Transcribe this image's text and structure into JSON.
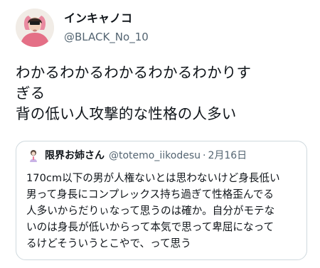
{
  "author": {
    "display_name": "インキャノコ",
    "handle": "@BLACK_No_10",
    "avatar_icon": "user-avatar-icon"
  },
  "tweet": {
    "text": "わかるわかるわかるわかるわかりす\nぎる\n背の低い人攻撃的な性格の人多い"
  },
  "quoted_tweet": {
    "display_name": "限界お姉さん",
    "handle": "@totemo_iikodesu",
    "separator": "·",
    "date": "2月16日",
    "avatar_icon": "quoted-avatar-icon",
    "text": "170cm以下の男が人権ないとは思わないけど身長低い\n男って身長にコンプレックス持ち過ぎて性格歪んでる\n人多いからだりぃなって思うのは確か。自分がモテな\nいのは身長が低いからって本気で思って卑屈になって\nるけどそういうとこやで、って思う"
  },
  "colors": {
    "text": "#0f1419",
    "secondary": "#536471",
    "border": "#cfd9de"
  }
}
